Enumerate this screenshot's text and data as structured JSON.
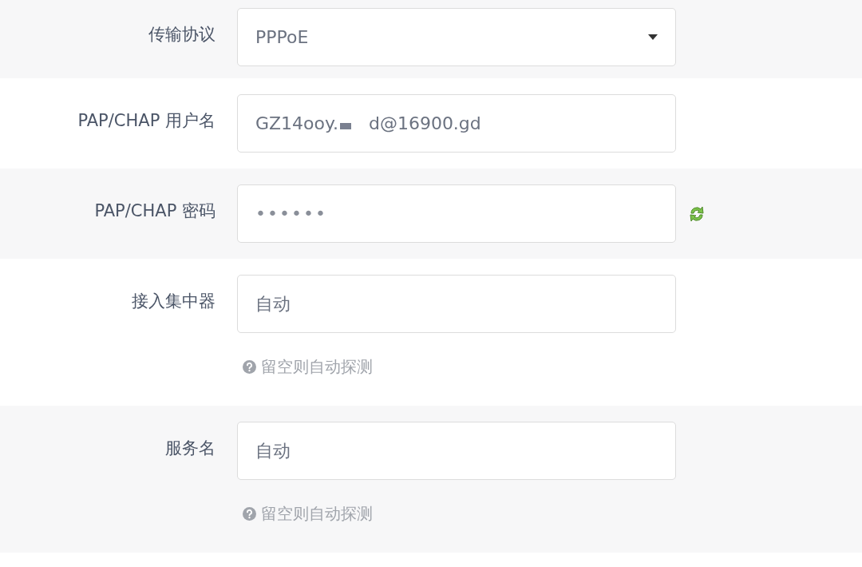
{
  "fields": [
    {
      "kind": "select",
      "label": "传输协议",
      "value": "PPPoE"
    },
    {
      "kind": "text",
      "label": "PAP/CHAP 用户名",
      "value": "GZ14ooy.",
      "redacted": true,
      "value_end": "d@16900.gd"
    },
    {
      "kind": "password",
      "label": "PAP/CHAP 密码",
      "value": "••••••"
    },
    {
      "kind": "text",
      "label": "接入集中器",
      "value": "自动",
      "hint": "留空则自动探测"
    },
    {
      "kind": "text",
      "label": "服务名",
      "value": "自动",
      "hint": "留空则自动探测"
    }
  ]
}
